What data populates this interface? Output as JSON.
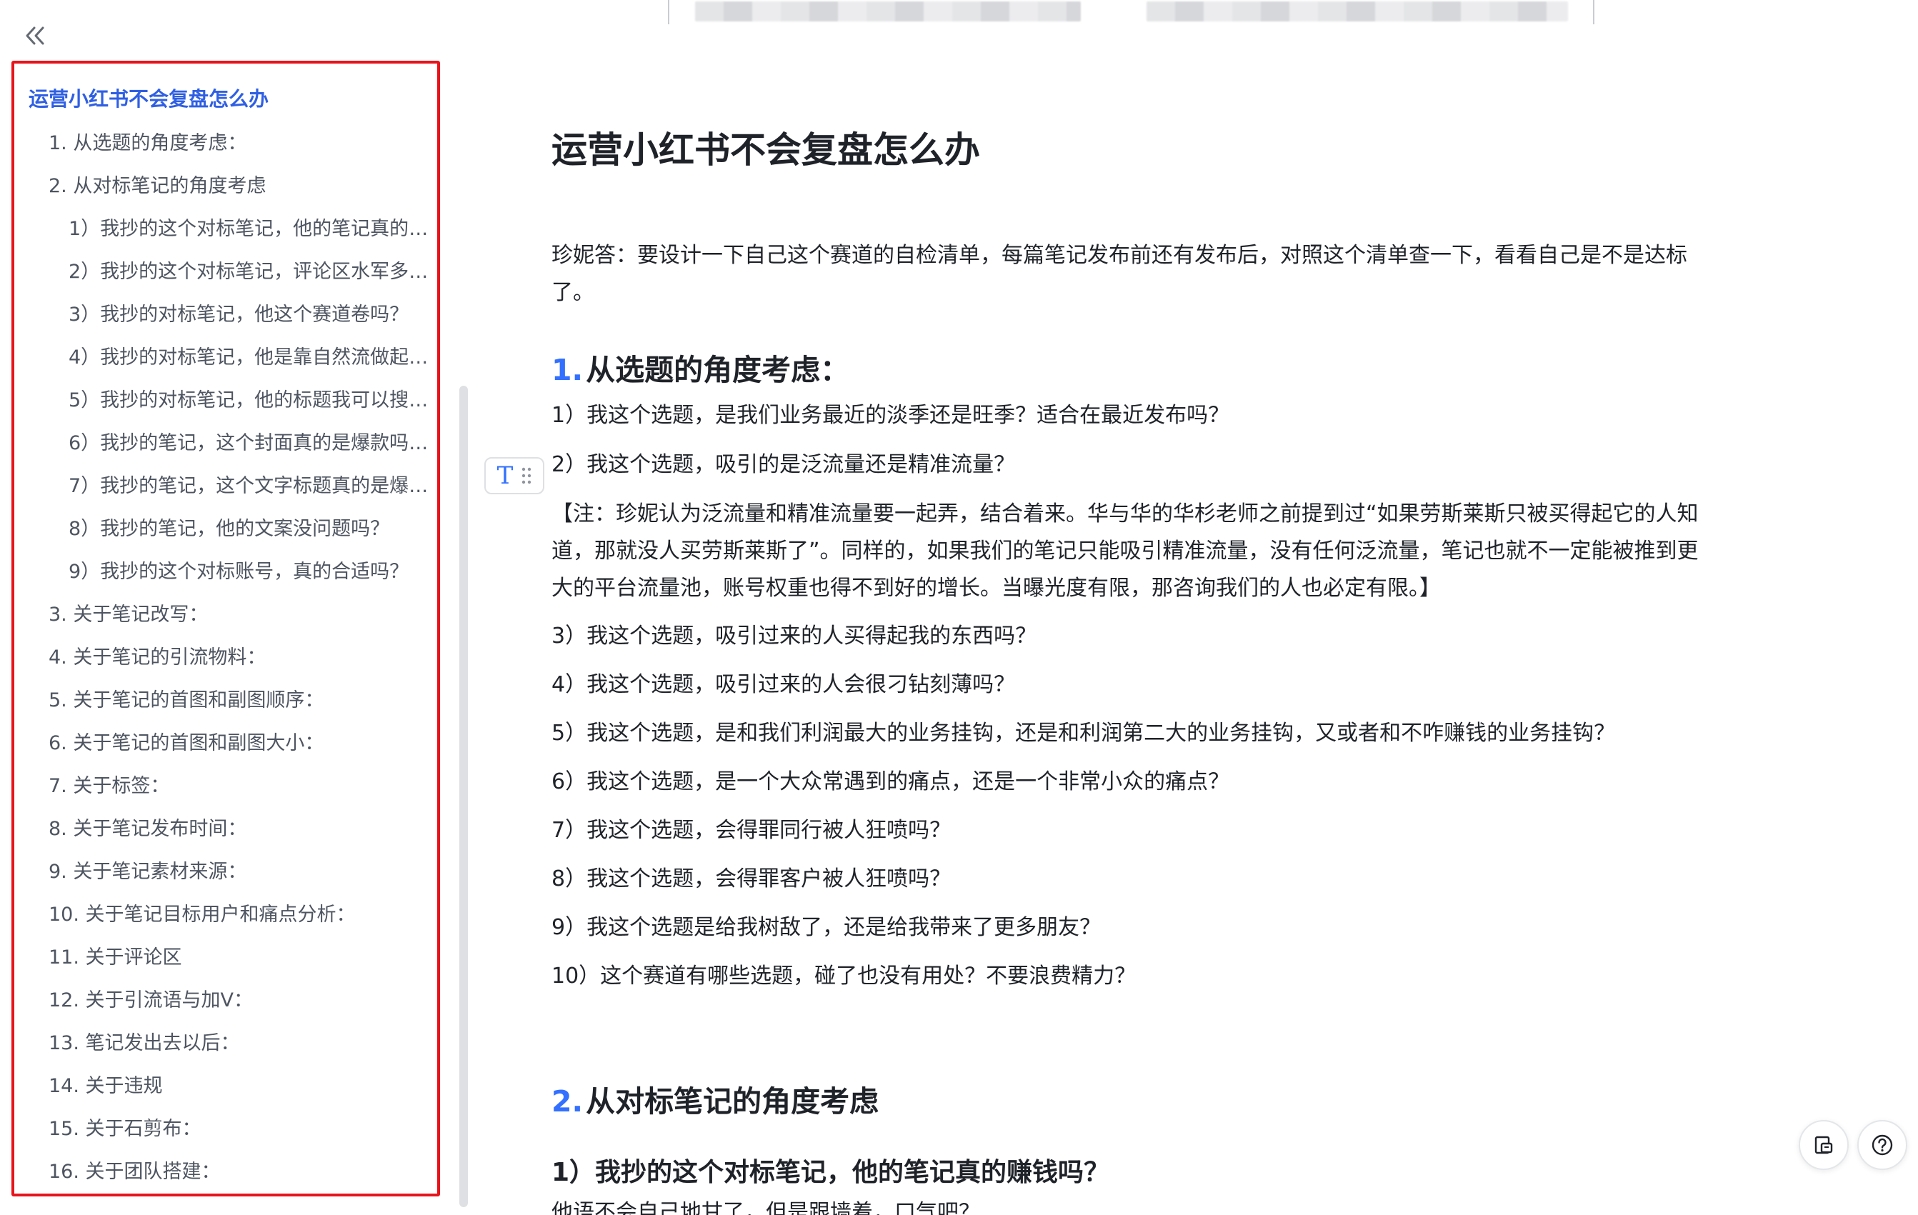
{
  "outline": {
    "items": [
      {
        "level": 0,
        "label": "运营小红书不会复盘怎么办"
      },
      {
        "level": 1,
        "label": "1. 从选题的角度考虑："
      },
      {
        "level": 1,
        "label": "2. 从对标笔记的角度考虑"
      },
      {
        "level": 2,
        "label": "1）我抄的这个对标笔记，他的笔记真的赚..."
      },
      {
        "level": 2,
        "label": "2）我抄的这个对标笔记，评论区水军多吗..."
      },
      {
        "level": 2,
        "label": "3）我抄的对标笔记，他这个赛道卷吗？"
      },
      {
        "level": 2,
        "label": "4）我抄的对标笔记，他是靠自然流做起来..."
      },
      {
        "level": 2,
        "label": "5）我抄的对标笔记，他的标题我可以搜索..."
      },
      {
        "level": 2,
        "label": "6）我抄的笔记，这个封面真的是爆款吗？..."
      },
      {
        "level": 2,
        "label": "7）我抄的笔记，这个文字标题真的是爆款..."
      },
      {
        "level": 2,
        "label": "8）我抄的笔记，他的文案没问题吗？"
      },
      {
        "level": 2,
        "label": "9）我抄的这个对标账号，真的合适吗？"
      },
      {
        "level": 1,
        "label": "3. 关于笔记改写："
      },
      {
        "level": 1,
        "label": "4. 关于笔记的引流物料："
      },
      {
        "level": 1,
        "label": "5. 关于笔记的首图和副图顺序："
      },
      {
        "level": 1,
        "label": "6. 关于笔记的首图和副图大小："
      },
      {
        "level": 1,
        "label": "7. 关于标签："
      },
      {
        "level": 1,
        "label": "8. 关于笔记发布时间："
      },
      {
        "level": 1,
        "label": "9. 关于笔记素材来源："
      },
      {
        "level": 1,
        "label": "10. 关于笔记目标用户和痛点分析："
      },
      {
        "level": 1,
        "label": "11. 关于评论区"
      },
      {
        "level": 1,
        "label": "12. 关于引流语与加V："
      },
      {
        "level": 1,
        "label": "13. 笔记发出去以后："
      },
      {
        "level": 1,
        "label": "14. 关于违规"
      },
      {
        "level": 1,
        "label": "15. 关于石剪布："
      },
      {
        "level": 1,
        "label": "16. 关于团队搭建："
      }
    ]
  },
  "doc": {
    "title": "运营小红书不会复盘怎么办",
    "intro": "珍妮答：要设计一下自己这个赛道的自检清单，每篇笔记发布前还有发布后，对照这个清单查一下，看看自己是不是达标了。",
    "section1": {
      "num": "1.",
      "title": "从选题的角度考虑：",
      "lines": [
        "1）我这个选题，是我们业务最近的淡季还是旺季？适合在最近发布吗？",
        "2）我这个选题，吸引的是泛流量还是精准流量？"
      ],
      "note": "【注：珍妮认为泛流量和精准流量要一起弄，结合着来。华与华的华杉老师之前提到过“如果劳斯莱斯只被买得起它的人知道，那就没人买劳斯莱斯了”。同样的，如果我们的笔记只能吸引精准流量，没有任何泛流量，笔记也就不一定能被推到更大的平台流量池，账号权重也得不到好的增长。当曝光度有限，那咨询我们的人也必定有限。】",
      "lines2": [
        "3）我这个选题，吸引过来的人买得起我的东西吗？",
        "4）我这个选题，吸引过来的人会很刁钻刻薄吗？",
        "5）我这个选题，是和我们利润最大的业务挂钩，还是和利润第二大的业务挂钩，又或者和不咋赚钱的业务挂钩？",
        "6）我这个选题，是一个大众常遇到的痛点，还是一个非常小众的痛点？",
        "7）我这个选题，会得罪同行被人狂喷吗？",
        "8）我这个选题，会得罪客户被人狂喷吗？",
        "9）我这个选题是给我树敌了，还是给我带来了更多朋友？",
        "10）这个赛道有哪些选题，碰了也没有用处？不要浪费精力？"
      ]
    },
    "section2": {
      "num": "2.",
      "title": "从对标笔记的角度考虑",
      "sub_title": "1）我抄的这个对标笔记，他的笔记真的赚钱吗？",
      "partial_line": "他语不会自己地甘了，但是跟墙着，口气吧？"
    }
  },
  "icons": {
    "collapse": "double-chevron-left-icon",
    "block_type": "text-type-icon",
    "drag": "drag-handle-icon",
    "doc_fab": "document-icon",
    "help_fab": "help-icon"
  },
  "colors": {
    "accent": "#3370ff",
    "outline_active": "#2f5fe3",
    "highlight_border": "#e8141c"
  }
}
